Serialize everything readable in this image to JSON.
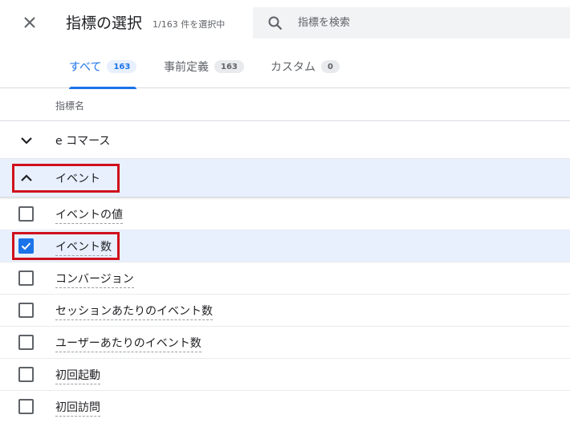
{
  "header": {
    "title": "指標の選択",
    "selection_count": "1/163 件を選択中",
    "close_icon": "close-icon",
    "search_icon": "search-icon",
    "search_placeholder": "指標を検索",
    "search_value": ""
  },
  "tabs": [
    {
      "label": "すべて",
      "count": "163",
      "active": true
    },
    {
      "label": "事前定義",
      "count": "163",
      "active": false
    },
    {
      "label": "カスタム",
      "count": "0",
      "active": false
    }
  ],
  "column_header": "指標名",
  "groups": [
    {
      "label": "e コマース",
      "expanded": false,
      "icon": "chevron-down-icon"
    },
    {
      "label": "イベント",
      "expanded": true,
      "icon": "chevron-up-icon"
    }
  ],
  "metrics": [
    {
      "label": "イベントの値",
      "checked": false
    },
    {
      "label": "イベント数",
      "checked": true
    },
    {
      "label": "コンバージョン",
      "checked": false
    },
    {
      "label": "セッションあたりのイベント数",
      "checked": false
    },
    {
      "label": "ユーザーあたりのイベント数",
      "checked": false
    },
    {
      "label": "初回起動",
      "checked": false
    },
    {
      "label": "初回訪問",
      "checked": false
    }
  ],
  "colors": {
    "accent": "#1a73e8",
    "selected_row": "#e8f0fe",
    "highlight_box": "#d0101c"
  }
}
